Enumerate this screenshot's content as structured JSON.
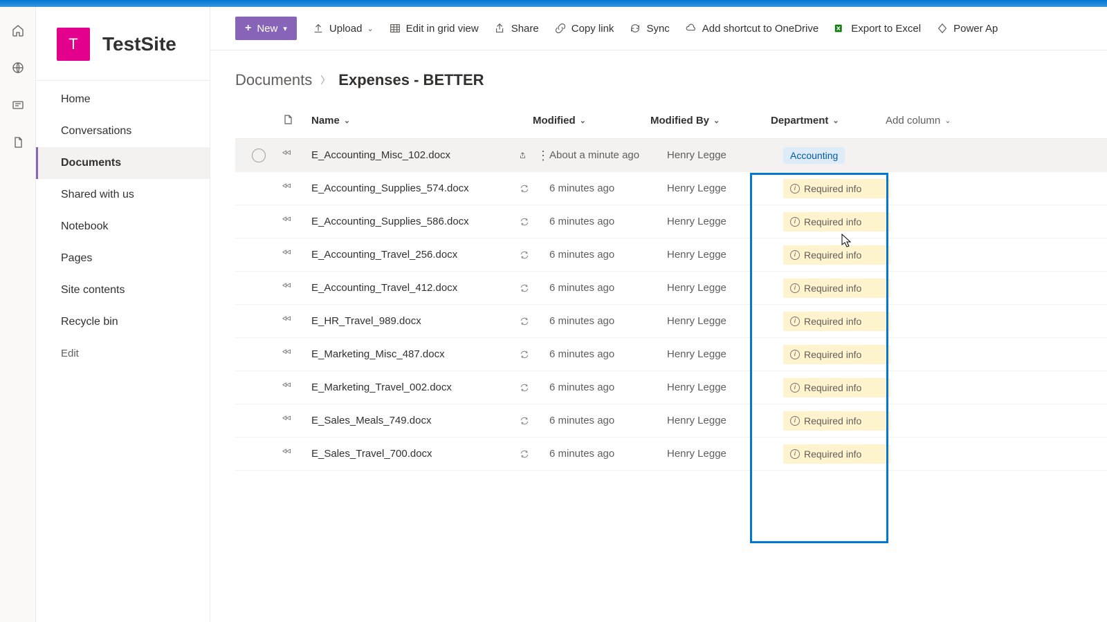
{
  "site": {
    "tile_letter": "T",
    "title": "TestSite"
  },
  "nav": {
    "items": [
      {
        "label": "Home"
      },
      {
        "label": "Conversations"
      },
      {
        "label": "Documents",
        "selected": true
      },
      {
        "label": "Shared with us"
      },
      {
        "label": "Notebook"
      },
      {
        "label": "Pages"
      },
      {
        "label": "Site contents"
      },
      {
        "label": "Recycle bin"
      }
    ],
    "edit_label": "Edit"
  },
  "toolbar": {
    "new_label": "New",
    "upload_label": "Upload",
    "edit_grid_label": "Edit in grid view",
    "share_label": "Share",
    "copylink_label": "Copy link",
    "sync_label": "Sync",
    "shortcut_label": "Add shortcut to OneDrive",
    "export_label": "Export to Excel",
    "powerapps_label": "Power Ap"
  },
  "breadcrumb": {
    "root": "Documents",
    "current": "Expenses - BETTER"
  },
  "columns": {
    "name": "Name",
    "modified": "Modified",
    "modified_by": "Modified By",
    "department": "Department",
    "add": "Add column"
  },
  "dept_tag": "Accounting",
  "required_info": "Required info",
  "rows": [
    {
      "name": "E_Accounting_Misc_102.docx",
      "modified": "About a minute ago",
      "by": "Henry Legge",
      "dept": "Accounting",
      "hover": true
    },
    {
      "name": "E_Accounting_Supplies_574.docx",
      "modified": "6 minutes ago",
      "by": "Henry Legge",
      "dept": null
    },
    {
      "name": "E_Accounting_Supplies_586.docx",
      "modified": "6 minutes ago",
      "by": "Henry Legge",
      "dept": null
    },
    {
      "name": "E_Accounting_Travel_256.docx",
      "modified": "6 minutes ago",
      "by": "Henry Legge",
      "dept": null
    },
    {
      "name": "E_Accounting_Travel_412.docx",
      "modified": "6 minutes ago",
      "by": "Henry Legge",
      "dept": null
    },
    {
      "name": "E_HR_Travel_989.docx",
      "modified": "6 minutes ago",
      "by": "Henry Legge",
      "dept": null
    },
    {
      "name": "E_Marketing_Misc_487.docx",
      "modified": "6 minutes ago",
      "by": "Henry Legge",
      "dept": null
    },
    {
      "name": "E_Marketing_Travel_002.docx",
      "modified": "6 minutes ago",
      "by": "Henry Legge",
      "dept": null
    },
    {
      "name": "E_Sales_Meals_749.docx",
      "modified": "6 minutes ago",
      "by": "Henry Legge",
      "dept": null
    },
    {
      "name": "E_Sales_Travel_700.docx",
      "modified": "6 minutes ago",
      "by": "Henry Legge",
      "dept": null
    }
  ]
}
